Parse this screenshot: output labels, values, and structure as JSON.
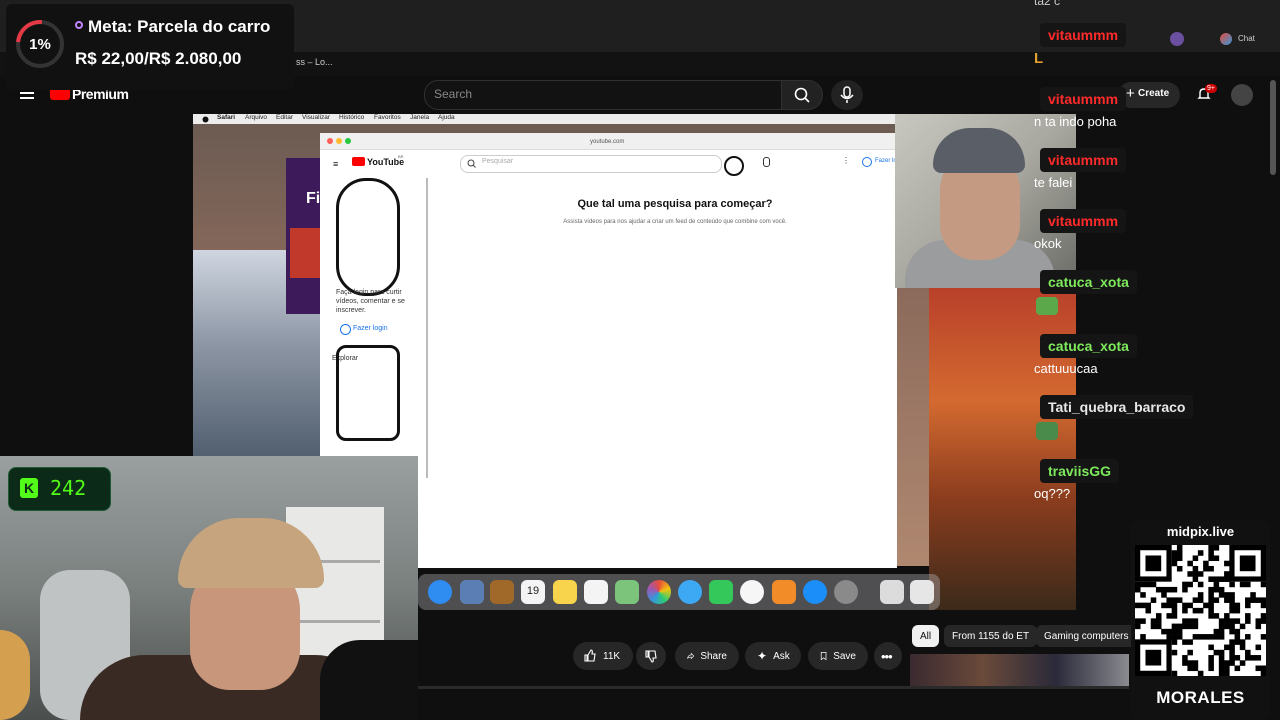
{
  "goal": {
    "percent": "1%",
    "progress": 0.01,
    "title": "Meta: Parcela do carro",
    "amount": "R$ 22,00/R$ 2.080,00"
  },
  "browser": {
    "tab_fragment": "ss – Lo...",
    "chat_label": "Chat"
  },
  "youtube_header": {
    "logo_text": "Premium",
    "search_placeholder": "Search",
    "create_label": "Create",
    "notification_badge": "9+"
  },
  "mac": {
    "menu_items": [
      "Safari",
      "Arquivo",
      "Editar",
      "Visualizar",
      "Histórico",
      "Favoritos",
      "Janela",
      "Ajuda"
    ],
    "url": "youtube.com",
    "calendar_month": "JUL",
    "calendar_day": "19"
  },
  "safari_youtube": {
    "logo_text": "YouTube",
    "logo_sup": "BR",
    "search_placeholder": "Pesquisar",
    "heading": "Que tal uma pesquisa para começar?",
    "subheading": "Assista vídeos para nos ajudar a criar um feed de conteúdo que combine com você.",
    "signin_text": "Faça login para curtir vídeos, comentar e se inscrever.",
    "login_link": "Fazer login",
    "header_login": "Fazer lo",
    "explore_label": "Explorar",
    "behind_text": "Fi"
  },
  "kick": {
    "viewer_count": "242"
  },
  "video_actions": {
    "like_count": "11K",
    "share_label": "Share",
    "ask_label": "Ask",
    "save_label": "Save",
    "chips": [
      "All",
      "From 1155 do ET",
      "Gaming computers"
    ]
  },
  "chat": {
    "top_fragment": "ta2 c",
    "messages": [
      {
        "user": "vitaummm",
        "text": "L"
      },
      {
        "user": "vitaummm",
        "text": "n ta indo poha"
      },
      {
        "user": "vitaummm",
        "text": "te falei"
      },
      {
        "user": "vitaummm",
        "text": "okok"
      },
      {
        "user": "catuca_xota",
        "text": ""
      },
      {
        "user": "catuca_xota",
        "text": "cattuuucaa"
      },
      {
        "user": "Tati_quebra_barraco",
        "text": ""
      },
      {
        "user": "traviisGG",
        "text": "oq???"
      }
    ]
  },
  "qr": {
    "title": "midpix.live",
    "brand": "MORALES"
  },
  "colors": {
    "chat_red": "#ff2a2a",
    "chat_green": "#7dea5c",
    "kick_green": "#53fc18",
    "yt_red": "#ff0000"
  }
}
